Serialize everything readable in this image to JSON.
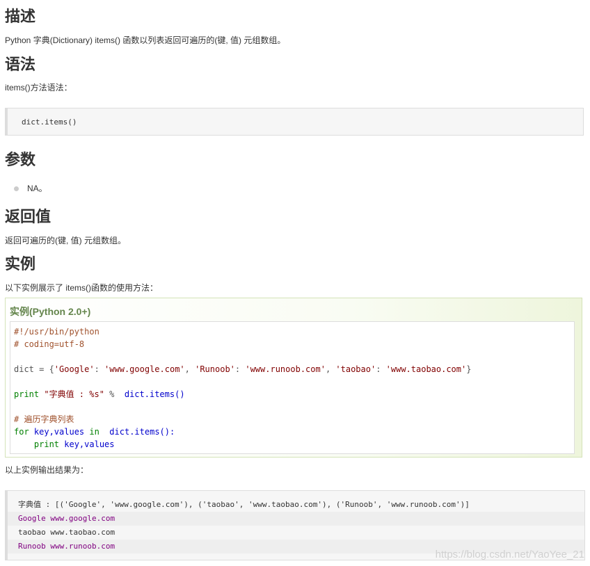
{
  "sections": {
    "desc_heading": "描述",
    "desc_text": "Python 字典(Dictionary) items() 函数以列表返回可遍历的(键, 值) 元组数组。",
    "syntax_heading": "语法",
    "syntax_text": "items()方法语法：",
    "syntax_code": "dict.items()",
    "params_heading": "参数",
    "params_item": "NA。",
    "return_heading": "返回值",
    "return_text": "返回可遍历的(键, 值) 元组数组。",
    "example_heading": "实例",
    "example_intro": "以下实例展示了 items()函数的使用方法：",
    "output_intro": "以上实例输出结果为："
  },
  "example": {
    "title": "实例(Python 2.0+)",
    "lines": {
      "l1": "#!/usr/bin/python",
      "l2": "# coding=utf-8",
      "l4a": "dict = {",
      "l4b": "'Google'",
      "l4c": ": ",
      "l4d": "'www.google.com'",
      "l4e": ", ",
      "l4f": "'Runoob'",
      "l4g": ": ",
      "l4h": "'www.runoob.com'",
      "l4i": ", ",
      "l4j": "'taobao'",
      "l4k": ": ",
      "l4l": "'www.taobao.com'",
      "l4m": "}",
      "l6a": "print ",
      "l6b": "\"字典值 : %s\"",
      "l6c": " %  ",
      "l6d": "dict.items()",
      "l8": "# 遍历字典列表",
      "l9a": "for ",
      "l9b": "key,values ",
      "l9c": "in  ",
      "l9d": "dict.items():",
      "l10a": "    print ",
      "l10b": "key,values"
    }
  },
  "output": {
    "rows": [
      "字典值 : [('Google', 'www.google.com'), ('taobao', 'www.taobao.com'), ('Runoob', 'www.runoob.com')]",
      "Google www.google.com",
      "taobao www.taobao.com",
      "Runoob www.runoob.com"
    ]
  },
  "watermark": "https://blog.csdn.net/YaoYee_21",
  "colors": {
    "example_title": "#64854c",
    "comment": "#a0522d",
    "keyword": "#008000",
    "string": "#800000"
  }
}
